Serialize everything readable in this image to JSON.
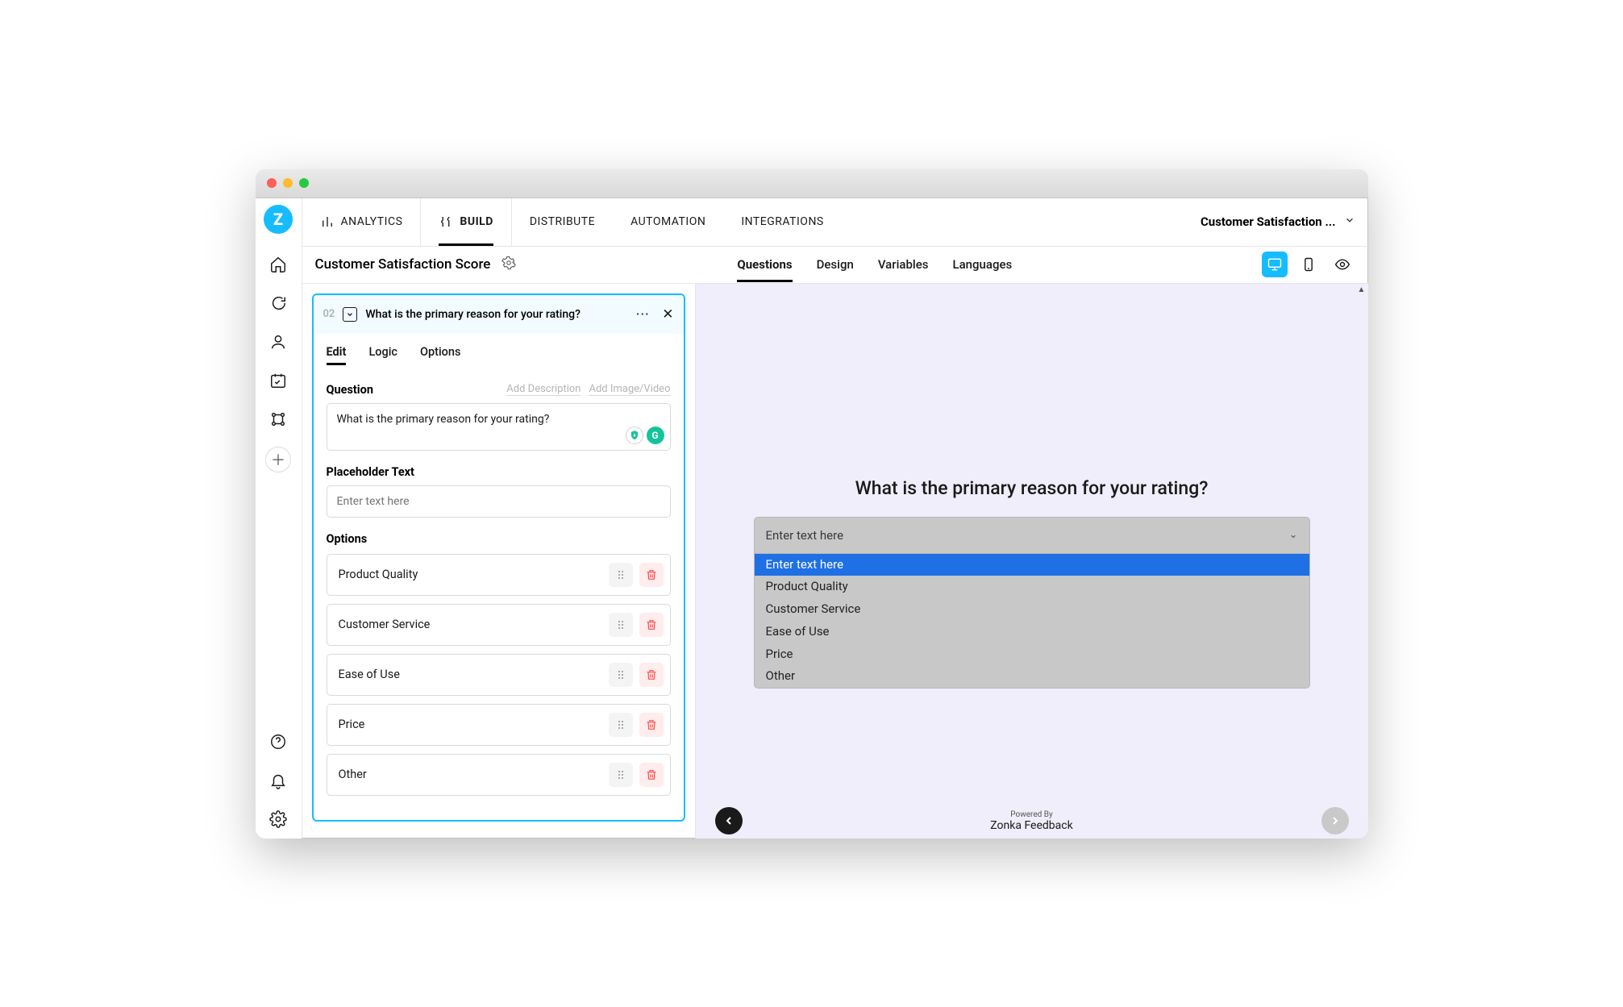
{
  "topnav": {
    "analytics": "ANALYTICS",
    "build": "BUILD",
    "distribute": "DISTRIBUTE",
    "automation": "AUTOMATION",
    "integrations": "INTEGRATIONS",
    "survey_selector": "Customer Satisfaction ..."
  },
  "subbar": {
    "survey_title": "Customer Satisfaction Score",
    "tabs": {
      "questions": "Questions",
      "design": "Design",
      "variables": "Variables",
      "languages": "Languages"
    }
  },
  "editor": {
    "question_number": "02",
    "question_title": "What is the primary reason for your rating?",
    "inner_tabs": {
      "edit": "Edit",
      "logic": "Logic",
      "options": "Options"
    },
    "question_label": "Question",
    "add_description": "Add Description",
    "add_media": "Add Image/Video",
    "question_value": "What is the primary reason for your rating?",
    "placeholder_label": "Placeholder Text",
    "placeholder_hint": "Enter text here",
    "options_label": "Options",
    "options": [
      "Product Quality",
      "Customer Service",
      "Ease of Use",
      "Price",
      "Other"
    ]
  },
  "preview": {
    "question": "What is the primary reason for your rating?",
    "select_placeholder": "Enter text here",
    "dropdown": [
      "Enter text here",
      "Product Quality",
      "Customer Service",
      "Ease of Use",
      "Price",
      "Other"
    ],
    "powered_by_small": "Powered By",
    "powered_by_brand": "Zonka Feedback"
  }
}
